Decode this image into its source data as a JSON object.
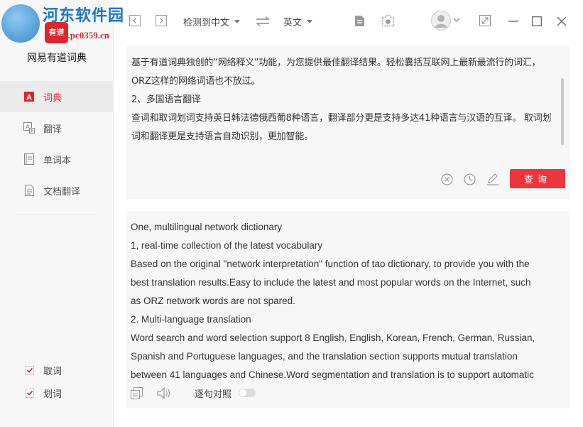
{
  "app": {
    "title": "网易有道词典",
    "logo_text": "有道"
  },
  "watermark": {
    "name": "河东软件园",
    "url": "www.pc0359.cn"
  },
  "sidebar": {
    "items": [
      {
        "label": "词典",
        "icon": "dictionary-icon",
        "active": true
      },
      {
        "label": "翻译",
        "icon": "translate-icon",
        "active": false
      },
      {
        "label": "单词本",
        "icon": "wordbook-icon",
        "active": false
      },
      {
        "label": "文档翻译",
        "icon": "document-translate-icon",
        "active": false
      }
    ],
    "options": [
      {
        "label": "取词",
        "checked": true
      },
      {
        "label": "划词",
        "checked": true
      }
    ]
  },
  "toolbar": {
    "source_lang": "检测到中文",
    "target_lang": "英文"
  },
  "input": {
    "lines": [
      "基于有道词典独创的“网络释义”功能，为您提供最佳翻译结果。轻松囊括互联网上最新最流行的词汇，",
      "ORZ这样的网络词语也不放过。",
      "2、多国语言翻译",
      "查词和取词划词支持英日韩法德俄西葡8种语言，翻译部分更是支持多达41种语言与汉语的互译。 取词划",
      "词和翻译更是支持语言自动识别，更加智能。"
    ],
    "query_label": "查询"
  },
  "output": {
    "lines": [
      "One, multilingual network dictionary",
      "1, real-time collection of the latest vocabulary",
      "Based on the original \"network interpretation\" function of tao dictionary, to provide you with the",
      "best translation results.Easy to include the latest and most popular words on the Internet, such",
      "as ORZ network words are not spared.",
      "2. Multi-language translation",
      "Word search and word selection support 8 English, English, Korean, French, German, Russian,",
      "Spanish and Portuguese languages, and the translation section supports mutual translation",
      "between 41 languages and Chinese.Word segmentation and translation is to support automatic"
    ],
    "sentence_align_label": "逐句对照",
    "sentence_align_on": false
  },
  "colors": {
    "accent": "#d8282e",
    "query_button": "#e8373d",
    "panel_bg": "#f7f7f7"
  }
}
